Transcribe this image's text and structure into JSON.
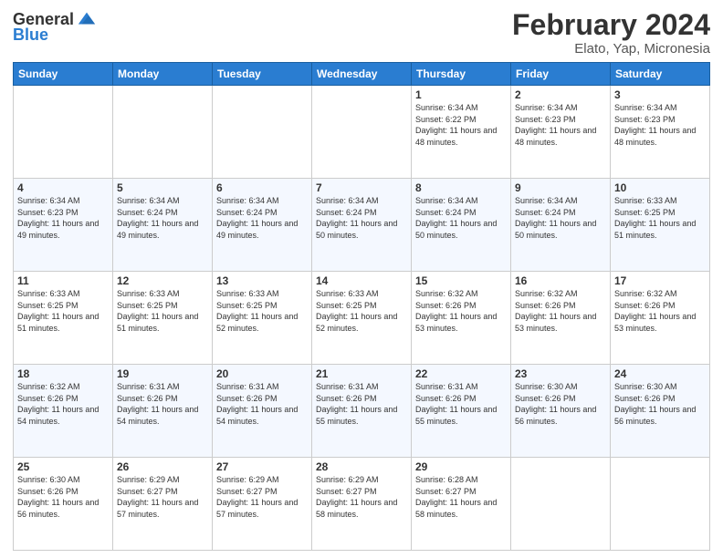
{
  "logo": {
    "general": "General",
    "blue": "Blue"
  },
  "title": {
    "month_year": "February 2024",
    "location": "Elato, Yap, Micronesia"
  },
  "days_of_week": [
    "Sunday",
    "Monday",
    "Tuesday",
    "Wednesday",
    "Thursday",
    "Friday",
    "Saturday"
  ],
  "weeks": [
    [
      {
        "day": "",
        "info": ""
      },
      {
        "day": "",
        "info": ""
      },
      {
        "day": "",
        "info": ""
      },
      {
        "day": "",
        "info": ""
      },
      {
        "day": "1",
        "info": "Sunrise: 6:34 AM\nSunset: 6:22 PM\nDaylight: 11 hours and 48 minutes."
      },
      {
        "day": "2",
        "info": "Sunrise: 6:34 AM\nSunset: 6:23 PM\nDaylight: 11 hours and 48 minutes."
      },
      {
        "day": "3",
        "info": "Sunrise: 6:34 AM\nSunset: 6:23 PM\nDaylight: 11 hours and 48 minutes."
      }
    ],
    [
      {
        "day": "4",
        "info": "Sunrise: 6:34 AM\nSunset: 6:23 PM\nDaylight: 11 hours and 49 minutes."
      },
      {
        "day": "5",
        "info": "Sunrise: 6:34 AM\nSunset: 6:24 PM\nDaylight: 11 hours and 49 minutes."
      },
      {
        "day": "6",
        "info": "Sunrise: 6:34 AM\nSunset: 6:24 PM\nDaylight: 11 hours and 49 minutes."
      },
      {
        "day": "7",
        "info": "Sunrise: 6:34 AM\nSunset: 6:24 PM\nDaylight: 11 hours and 50 minutes."
      },
      {
        "day": "8",
        "info": "Sunrise: 6:34 AM\nSunset: 6:24 PM\nDaylight: 11 hours and 50 minutes."
      },
      {
        "day": "9",
        "info": "Sunrise: 6:34 AM\nSunset: 6:24 PM\nDaylight: 11 hours and 50 minutes."
      },
      {
        "day": "10",
        "info": "Sunrise: 6:33 AM\nSunset: 6:25 PM\nDaylight: 11 hours and 51 minutes."
      }
    ],
    [
      {
        "day": "11",
        "info": "Sunrise: 6:33 AM\nSunset: 6:25 PM\nDaylight: 11 hours and 51 minutes."
      },
      {
        "day": "12",
        "info": "Sunrise: 6:33 AM\nSunset: 6:25 PM\nDaylight: 11 hours and 51 minutes."
      },
      {
        "day": "13",
        "info": "Sunrise: 6:33 AM\nSunset: 6:25 PM\nDaylight: 11 hours and 52 minutes."
      },
      {
        "day": "14",
        "info": "Sunrise: 6:33 AM\nSunset: 6:25 PM\nDaylight: 11 hours and 52 minutes."
      },
      {
        "day": "15",
        "info": "Sunrise: 6:32 AM\nSunset: 6:26 PM\nDaylight: 11 hours and 53 minutes."
      },
      {
        "day": "16",
        "info": "Sunrise: 6:32 AM\nSunset: 6:26 PM\nDaylight: 11 hours and 53 minutes."
      },
      {
        "day": "17",
        "info": "Sunrise: 6:32 AM\nSunset: 6:26 PM\nDaylight: 11 hours and 53 minutes."
      }
    ],
    [
      {
        "day": "18",
        "info": "Sunrise: 6:32 AM\nSunset: 6:26 PM\nDaylight: 11 hours and 54 minutes."
      },
      {
        "day": "19",
        "info": "Sunrise: 6:31 AM\nSunset: 6:26 PM\nDaylight: 11 hours and 54 minutes."
      },
      {
        "day": "20",
        "info": "Sunrise: 6:31 AM\nSunset: 6:26 PM\nDaylight: 11 hours and 54 minutes."
      },
      {
        "day": "21",
        "info": "Sunrise: 6:31 AM\nSunset: 6:26 PM\nDaylight: 11 hours and 55 minutes."
      },
      {
        "day": "22",
        "info": "Sunrise: 6:31 AM\nSunset: 6:26 PM\nDaylight: 11 hours and 55 minutes."
      },
      {
        "day": "23",
        "info": "Sunrise: 6:30 AM\nSunset: 6:26 PM\nDaylight: 11 hours and 56 minutes."
      },
      {
        "day": "24",
        "info": "Sunrise: 6:30 AM\nSunset: 6:26 PM\nDaylight: 11 hours and 56 minutes."
      }
    ],
    [
      {
        "day": "25",
        "info": "Sunrise: 6:30 AM\nSunset: 6:26 PM\nDaylight: 11 hours and 56 minutes."
      },
      {
        "day": "26",
        "info": "Sunrise: 6:29 AM\nSunset: 6:27 PM\nDaylight: 11 hours and 57 minutes."
      },
      {
        "day": "27",
        "info": "Sunrise: 6:29 AM\nSunset: 6:27 PM\nDaylight: 11 hours and 57 minutes."
      },
      {
        "day": "28",
        "info": "Sunrise: 6:29 AM\nSunset: 6:27 PM\nDaylight: 11 hours and 58 minutes."
      },
      {
        "day": "29",
        "info": "Sunrise: 6:28 AM\nSunset: 6:27 PM\nDaylight: 11 hours and 58 minutes."
      },
      {
        "day": "",
        "info": ""
      },
      {
        "day": "",
        "info": ""
      }
    ]
  ]
}
